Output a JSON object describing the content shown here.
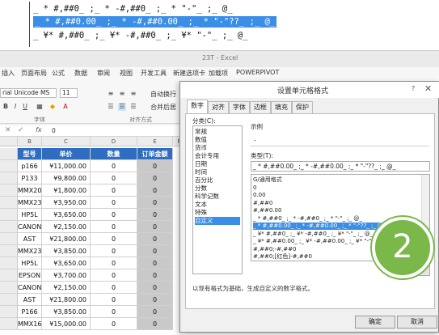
{
  "code_lines": [
    "_ * #,##0_ ;_ * -#,##0_ ;_ * \"-\"_ ;_ @_",
    "_ * #,##0.00_ ;_ * -#,##0.00_ ;_ * \"-\"??_ ;_ @_",
    "_ ¥* #,##0_ ;_ ¥* -#,##0_ ;_ ¥* \"-\"_ ;_ @_"
  ],
  "window_title": "23T - Excel",
  "ribbon_tabs": [
    "插入",
    "页面布局",
    "公式",
    "数据",
    "审阅",
    "视图",
    "开发工具",
    "新建选项卡",
    "加载项",
    "POWERPIVOT"
  ],
  "ribbon": {
    "font_name": "rial Unicode MS",
    "font_size": "11",
    "wrap_label": "自动换行",
    "merge_label": "合并后居",
    "group_font": "字体",
    "group_align": "对齐方式"
  },
  "formula_bar": {
    "fx": "fx",
    "value": "0"
  },
  "grid": {
    "col_letters": [
      "B",
      "C",
      "D",
      "E",
      "F"
    ],
    "headers": [
      "型号",
      "单价",
      "数量",
      "订单金额"
    ],
    "rows": [
      [
        "p166",
        "¥11,000.00",
        "0",
        "0"
      ],
      [
        "P133",
        "¥9,800.00",
        "0",
        "0"
      ],
      [
        "MMX200",
        "¥1,800.00",
        "0",
        "0"
      ],
      [
        "MMX233",
        "¥3,950.00",
        "0",
        "0"
      ],
      [
        "HP5L",
        "¥3,650.00",
        "0",
        "0"
      ],
      [
        "CANON",
        "¥2,150.00",
        "0",
        "0"
      ],
      [
        "AST",
        "¥21,800.00",
        "0",
        "0"
      ],
      [
        "MMX233",
        "¥3,850.00",
        "0",
        "0"
      ],
      [
        "HP5L",
        "¥3,650.00",
        "0",
        "0"
      ],
      [
        "EPSON",
        "¥3,700.00",
        "0",
        "0"
      ],
      [
        "CANON",
        "¥2,150.00",
        "0",
        "0"
      ],
      [
        "AST",
        "¥21,800.00",
        "0",
        "0"
      ],
      [
        "P166",
        "¥3,850.00",
        "0",
        "0"
      ],
      [
        "MMX166",
        "¥15,000.00",
        "0",
        "0"
      ]
    ]
  },
  "dialog": {
    "title": "设置单元格格式",
    "help": "?",
    "close": "✕",
    "tabs": [
      "数字",
      "对齐",
      "字体",
      "边框",
      "填充",
      "保护"
    ],
    "category_label": "分类(C):",
    "categories": [
      "常规",
      "数值",
      "货币",
      "会计专用",
      "日期",
      "时间",
      "百分比",
      "分数",
      "科学记数",
      "文本",
      "特殊",
      "自定义"
    ],
    "selected_category": "自定义",
    "sample_label": "示例",
    "sample_value": "-",
    "type_label": "类型(T):",
    "type_value": "_ * #,##0.00_ ;_ * -#,##0.00_ ;_ * \"-\"??_ ;_ @_",
    "formats": [
      "G/通用格式",
      "0",
      "0.00",
      "#,##0",
      "#,##0.00",
      "_ * #,##0_ ;_ * -#,##0_ ;_ * \"-\"_ ;_ @_",
      "_ * #,##0.00_ ;_ * -#,##0.00_ ;_ * \"-\"??_ ;_ @_",
      "_ ¥* #,##0_ ;_ ¥* -#,##0_ ;_ ¥* \"-\"_ ;_ @_",
      "_ ¥* #,##0.00_ ;_ ¥* -#,##0.00_ ;_ ¥* \"-\"??_ ;_ @_",
      "#,##0;-#,##0",
      "#,##0;[红色]-#,##0"
    ],
    "selected_format_index": 6,
    "delete_label": "删除(D)",
    "hint": "以现有格式为基础，生成自定义的数字格式。",
    "ok_label": "确定",
    "cancel_label": "取消"
  },
  "badge": "2",
  "colors": {
    "header_blue": "#2e6dbf",
    "select_blue": "#3a8ee6",
    "badge_green": "#7ab84a",
    "gray_cell": "#c9c9c9"
  }
}
